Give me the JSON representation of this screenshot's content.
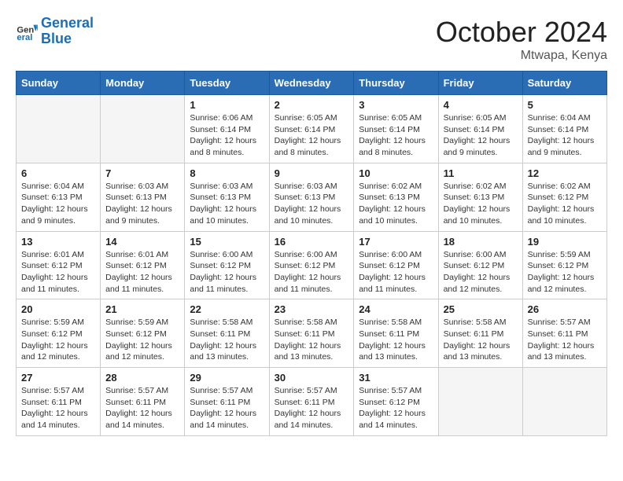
{
  "logo": {
    "text_general": "General",
    "text_blue": "Blue"
  },
  "header": {
    "month": "October 2024",
    "location": "Mtwapa, Kenya"
  },
  "days_of_week": [
    "Sunday",
    "Monday",
    "Tuesday",
    "Wednesday",
    "Thursday",
    "Friday",
    "Saturday"
  ],
  "weeks": [
    [
      {
        "day": "",
        "info": ""
      },
      {
        "day": "",
        "info": ""
      },
      {
        "day": "1",
        "info": "Sunrise: 6:06 AM\nSunset: 6:14 PM\nDaylight: 12 hours and 8 minutes."
      },
      {
        "day": "2",
        "info": "Sunrise: 6:05 AM\nSunset: 6:14 PM\nDaylight: 12 hours and 8 minutes."
      },
      {
        "day": "3",
        "info": "Sunrise: 6:05 AM\nSunset: 6:14 PM\nDaylight: 12 hours and 8 minutes."
      },
      {
        "day": "4",
        "info": "Sunrise: 6:05 AM\nSunset: 6:14 PM\nDaylight: 12 hours and 9 minutes."
      },
      {
        "day": "5",
        "info": "Sunrise: 6:04 AM\nSunset: 6:14 PM\nDaylight: 12 hours and 9 minutes."
      }
    ],
    [
      {
        "day": "6",
        "info": "Sunrise: 6:04 AM\nSunset: 6:13 PM\nDaylight: 12 hours and 9 minutes."
      },
      {
        "day": "7",
        "info": "Sunrise: 6:03 AM\nSunset: 6:13 PM\nDaylight: 12 hours and 9 minutes."
      },
      {
        "day": "8",
        "info": "Sunrise: 6:03 AM\nSunset: 6:13 PM\nDaylight: 12 hours and 10 minutes."
      },
      {
        "day": "9",
        "info": "Sunrise: 6:03 AM\nSunset: 6:13 PM\nDaylight: 12 hours and 10 minutes."
      },
      {
        "day": "10",
        "info": "Sunrise: 6:02 AM\nSunset: 6:13 PM\nDaylight: 12 hours and 10 minutes."
      },
      {
        "day": "11",
        "info": "Sunrise: 6:02 AM\nSunset: 6:13 PM\nDaylight: 12 hours and 10 minutes."
      },
      {
        "day": "12",
        "info": "Sunrise: 6:02 AM\nSunset: 6:12 PM\nDaylight: 12 hours and 10 minutes."
      }
    ],
    [
      {
        "day": "13",
        "info": "Sunrise: 6:01 AM\nSunset: 6:12 PM\nDaylight: 12 hours and 11 minutes."
      },
      {
        "day": "14",
        "info": "Sunrise: 6:01 AM\nSunset: 6:12 PM\nDaylight: 12 hours and 11 minutes."
      },
      {
        "day": "15",
        "info": "Sunrise: 6:00 AM\nSunset: 6:12 PM\nDaylight: 12 hours and 11 minutes."
      },
      {
        "day": "16",
        "info": "Sunrise: 6:00 AM\nSunset: 6:12 PM\nDaylight: 12 hours and 11 minutes."
      },
      {
        "day": "17",
        "info": "Sunrise: 6:00 AM\nSunset: 6:12 PM\nDaylight: 12 hours and 11 minutes."
      },
      {
        "day": "18",
        "info": "Sunrise: 6:00 AM\nSunset: 6:12 PM\nDaylight: 12 hours and 12 minutes."
      },
      {
        "day": "19",
        "info": "Sunrise: 5:59 AM\nSunset: 6:12 PM\nDaylight: 12 hours and 12 minutes."
      }
    ],
    [
      {
        "day": "20",
        "info": "Sunrise: 5:59 AM\nSunset: 6:12 PM\nDaylight: 12 hours and 12 minutes."
      },
      {
        "day": "21",
        "info": "Sunrise: 5:59 AM\nSunset: 6:12 PM\nDaylight: 12 hours and 12 minutes."
      },
      {
        "day": "22",
        "info": "Sunrise: 5:58 AM\nSunset: 6:11 PM\nDaylight: 12 hours and 13 minutes."
      },
      {
        "day": "23",
        "info": "Sunrise: 5:58 AM\nSunset: 6:11 PM\nDaylight: 12 hours and 13 minutes."
      },
      {
        "day": "24",
        "info": "Sunrise: 5:58 AM\nSunset: 6:11 PM\nDaylight: 12 hours and 13 minutes."
      },
      {
        "day": "25",
        "info": "Sunrise: 5:58 AM\nSunset: 6:11 PM\nDaylight: 12 hours and 13 minutes."
      },
      {
        "day": "26",
        "info": "Sunrise: 5:57 AM\nSunset: 6:11 PM\nDaylight: 12 hours and 13 minutes."
      }
    ],
    [
      {
        "day": "27",
        "info": "Sunrise: 5:57 AM\nSunset: 6:11 PM\nDaylight: 12 hours and 14 minutes."
      },
      {
        "day": "28",
        "info": "Sunrise: 5:57 AM\nSunset: 6:11 PM\nDaylight: 12 hours and 14 minutes."
      },
      {
        "day": "29",
        "info": "Sunrise: 5:57 AM\nSunset: 6:11 PM\nDaylight: 12 hours and 14 minutes."
      },
      {
        "day": "30",
        "info": "Sunrise: 5:57 AM\nSunset: 6:11 PM\nDaylight: 12 hours and 14 minutes."
      },
      {
        "day": "31",
        "info": "Sunrise: 5:57 AM\nSunset: 6:12 PM\nDaylight: 12 hours and 14 minutes."
      },
      {
        "day": "",
        "info": ""
      },
      {
        "day": "",
        "info": ""
      }
    ]
  ]
}
